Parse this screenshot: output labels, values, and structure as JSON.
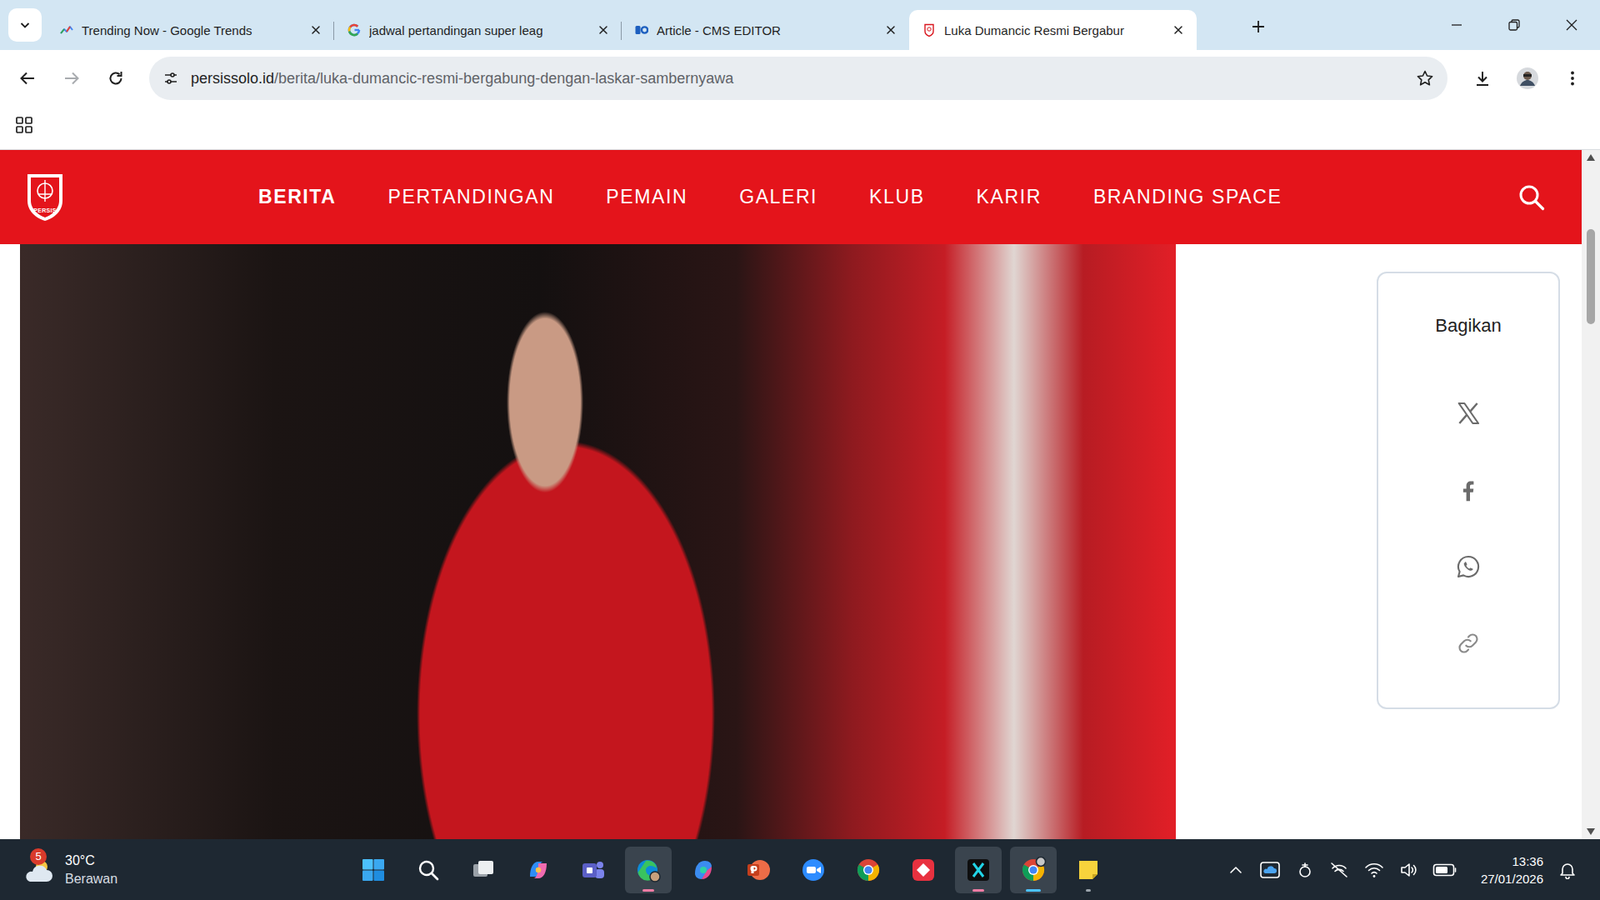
{
  "tabs": [
    {
      "label": "Trending Now - Google Trends",
      "selected": false,
      "kind": "trends"
    },
    {
      "label": "jadwal pertandingan super leag",
      "selected": false,
      "kind": "google"
    },
    {
      "label": "Article - CMS EDITOR",
      "selected": false,
      "kind": "cms"
    },
    {
      "label": "Luka Dumancic Resmi Bergabur",
      "selected": true,
      "kind": "persis"
    }
  ],
  "browser": {
    "forward_enabled": false
  },
  "address": {
    "domain": "persissolo.id",
    "path": "/berita/luka-dumancic-resmi-bergabung-dengan-laskar-sambernyawa"
  },
  "nav": {
    "logo": "PERSIS",
    "items": [
      {
        "label": "BERITA",
        "selected": true
      },
      {
        "label": "PERTANDINGAN",
        "selected": false
      },
      {
        "label": "PEMAIN",
        "selected": false
      },
      {
        "label": "GALERI",
        "selected": false
      },
      {
        "label": "KLUB",
        "selected": false
      },
      {
        "label": "KARIR",
        "selected": false
      },
      {
        "label": "BRANDING SPACE",
        "selected": false
      }
    ]
  },
  "share": {
    "title": "Bagikan",
    "items": [
      {
        "kind": "x"
      },
      {
        "kind": "facebook"
      },
      {
        "kind": "whatsapp"
      },
      {
        "kind": "link"
      }
    ]
  },
  "taskbar": {
    "weather": {
      "temp": "30°C",
      "condition": "Berawan",
      "badge": "5"
    },
    "apps": [
      {
        "kind": "start",
        "open": false,
        "focused": false,
        "flashing": false
      },
      {
        "kind": "search",
        "open": false,
        "focused": false,
        "flashing": false
      },
      {
        "kind": "taskview",
        "open": false,
        "focused": false,
        "flashing": false
      },
      {
        "kind": "copilot",
        "open": false,
        "focused": false,
        "flashing": false
      },
      {
        "kind": "teams",
        "open": false,
        "focused": false,
        "flashing": false
      },
      {
        "kind": "edge",
        "open": true,
        "focused": false,
        "flashing": true
      },
      {
        "kind": "m365",
        "open": false,
        "focused": false,
        "flashing": false
      },
      {
        "kind": "powerpoint",
        "open": false,
        "focused": false,
        "flashing": false
      },
      {
        "kind": "zoom",
        "open": false,
        "focused": false,
        "flashing": false
      },
      {
        "kind": "chrome",
        "open": false,
        "focused": false,
        "flashing": false
      },
      {
        "kind": "wps",
        "open": false,
        "focused": false,
        "flashing": false
      },
      {
        "kind": "capcut",
        "open": true,
        "focused": false,
        "flashing": true
      },
      {
        "kind": "chromeprofile",
        "open": true,
        "focused": true,
        "flashing": false
      },
      {
        "kind": "sticky",
        "open": true,
        "focused": false,
        "flashing": false
      }
    ],
    "clock": {
      "time": "13:36",
      "date": "27/01/2026"
    }
  }
}
